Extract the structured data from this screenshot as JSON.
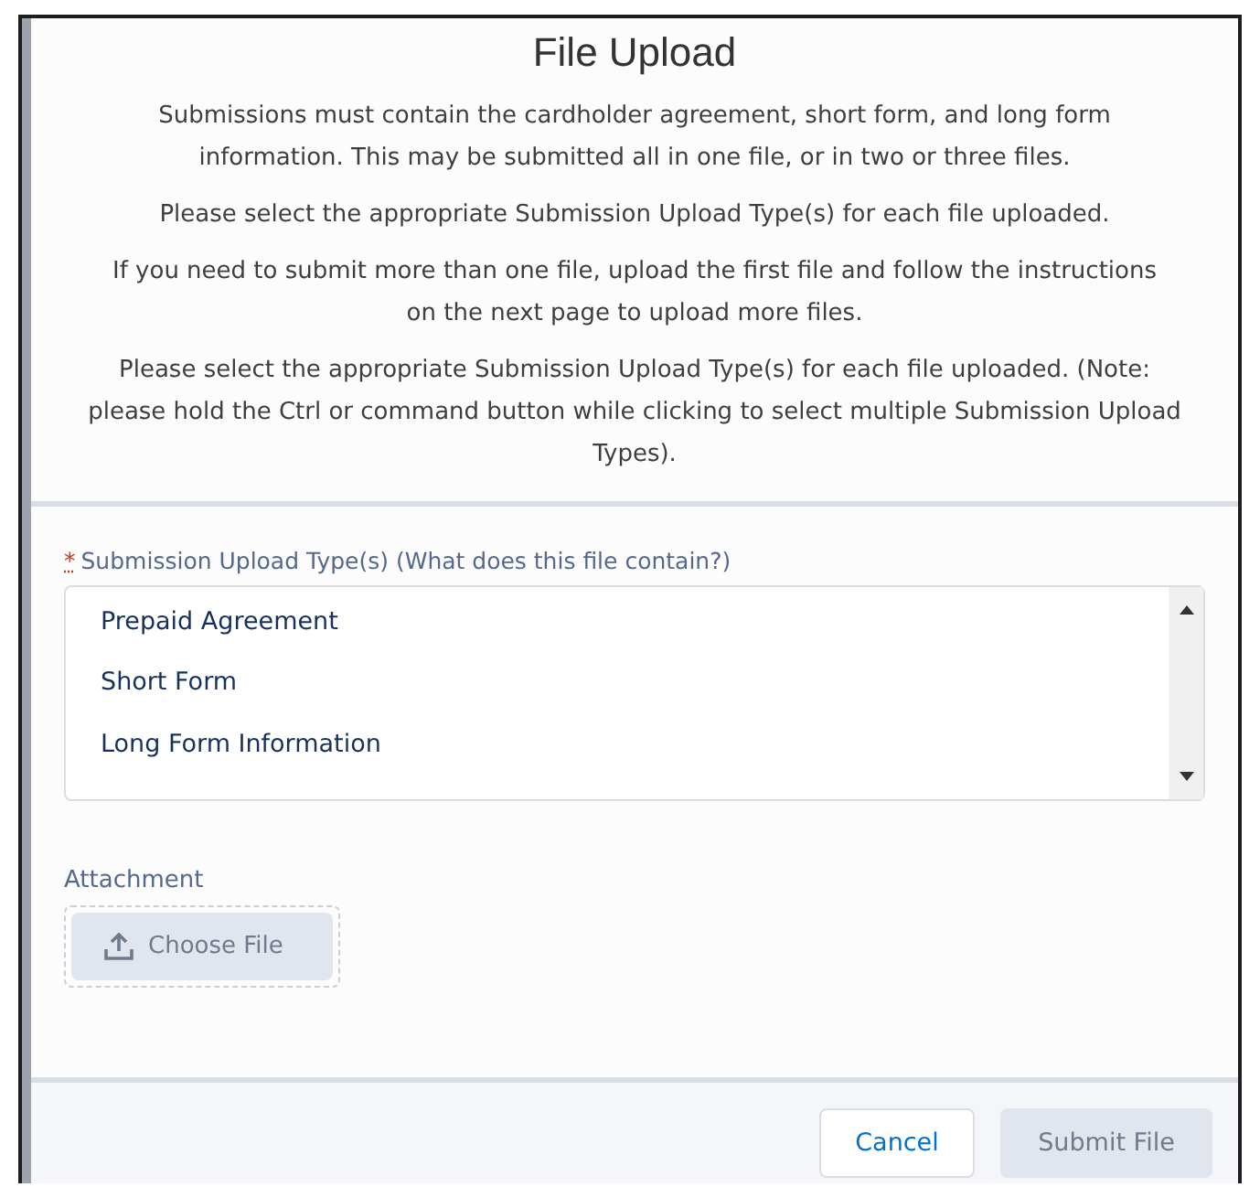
{
  "title": "File Upload",
  "paragraphs": [
    "Submissions must contain the cardholder agreement, short form, and long form information. This may be submitted all in one file, or in two or three files.",
    "Please select the appropriate Submission Upload Type(s) for each file uploaded.",
    "If you need to submit more than one file, upload the first file and follow the instructions on the next page to upload more files.",
    "Please select the appropriate Submission Upload Type(s) for each file uploaded. (Note: please hold the Ctrl or command button while clicking to select multiple Submission Upload Types)."
  ],
  "field": {
    "required_mark": "*",
    "label": "Submission Upload Type(s) (What does this file contain?)",
    "options": [
      {
        "label": "Prepaid Agreement",
        "selected": false
      },
      {
        "label": "Short Form",
        "selected": false
      },
      {
        "label": "Long Form Information",
        "selected": false
      }
    ]
  },
  "attachment": {
    "label": "Attachment",
    "button": {
      "label": "Choose File",
      "disabled": true
    }
  },
  "buttons": [
    {
      "label": "Cancel",
      "kind": "neutral",
      "disabled": false
    },
    {
      "label": "Submit File",
      "kind": "brand",
      "disabled": true
    }
  ]
}
